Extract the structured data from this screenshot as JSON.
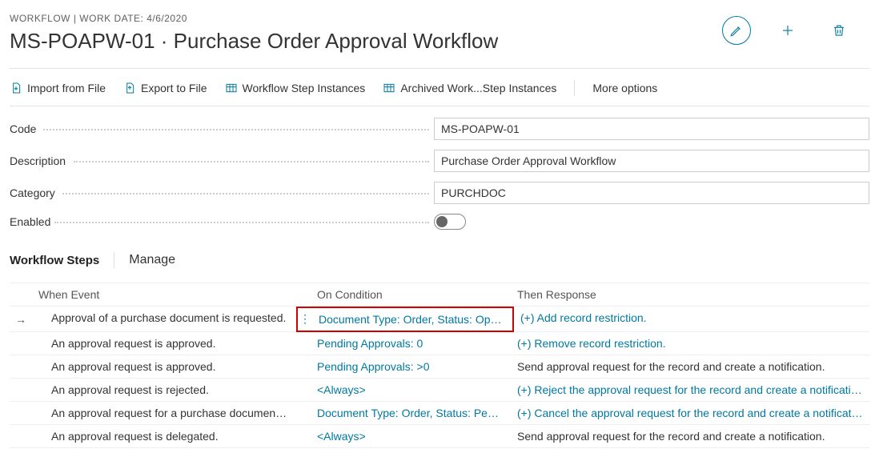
{
  "breadcrumb": "WORKFLOW | WORK DATE: 4/6/2020",
  "page_title": "MS-POAPW-01 · Purchase Order Approval Workflow",
  "toolbar": {
    "import": "Import from File",
    "export": "Export to File",
    "step_instances": "Workflow Step Instances",
    "archived": "Archived Work...Step Instances",
    "more": "More options"
  },
  "form": {
    "code_label": "Code",
    "code_value": "MS-POAPW-01",
    "desc_label": "Description",
    "desc_value": "Purchase Order Approval Workflow",
    "cat_label": "Category",
    "cat_value": "PURCHDOC",
    "enabled_label": "Enabled"
  },
  "section": {
    "title": "Workflow Steps",
    "manage": "Manage"
  },
  "grid": {
    "headers": {
      "event": "When Event",
      "cond": "On Condition",
      "resp": "Then Response"
    },
    "rows": [
      {
        "arrow": true,
        "indent": 1,
        "event": "Approval of a purchase document is requested.",
        "cond": "Document Type: Order, Status: Open, ...",
        "resp": "(+) Add record restriction.",
        "cond_link": true,
        "resp_link": true,
        "highlight": true
      },
      {
        "arrow": false,
        "indent": 1,
        "event": "An approval request is approved.",
        "cond": "Pending Approvals: 0",
        "resp": "(+) Remove record restriction.",
        "cond_link": true,
        "resp_link": true
      },
      {
        "arrow": false,
        "indent": 1,
        "event": "An approval request is approved.",
        "cond": "Pending Approvals: >0",
        "resp": "Send approval request for the record and create a notification.",
        "cond_link": true,
        "resp_link": false
      },
      {
        "arrow": false,
        "indent": 1,
        "event": "An approval request is rejected.",
        "cond": "<Always>",
        "resp": "(+) Reject the approval request for the record and create a notification.",
        "cond_link": true,
        "resp_link": true
      },
      {
        "arrow": false,
        "indent": 1,
        "event": "An approval request for a purchase document is ca...",
        "cond": "Document Type: Order, Status: Pendin...",
        "resp": "(+) Cancel the approval request for the record and create a notification.",
        "cond_link": true,
        "resp_link": true
      },
      {
        "arrow": false,
        "indent": 1,
        "event": "An approval request is delegated.",
        "cond": "<Always>",
        "resp": "Send approval request for the record and create a notification.",
        "cond_link": true,
        "resp_link": false
      }
    ]
  }
}
